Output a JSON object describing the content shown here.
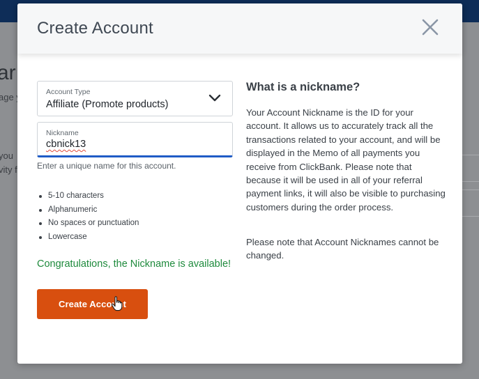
{
  "modal": {
    "title": "Create Account",
    "close_icon": "close-icon"
  },
  "form": {
    "account_type": {
      "label": "Account Type",
      "value": "Affiliate (Promote products)"
    },
    "nickname": {
      "label": "Nickname",
      "value": "cbnick13",
      "helper": "Enter a unique name for this account."
    },
    "rules": [
      "5-10 characters",
      "Alphanumeric",
      "No spaces or punctuation",
      "Lowercase"
    ],
    "status": "Congratulations, the Nickname is available!",
    "submit_label": "Create Account"
  },
  "info": {
    "title": "What is a nickname?",
    "body": "Your Account Nickname is the ID for your account. It allows us to accurately track all the transactions related to your account, and will be displayed in the Memo of all payments you receive from ClickBank. Please note that because it will be used in all of your referral payment links, it will also be visible to purchasing customers during the order process.",
    "note": "Please note that Account Nicknames cannot be changed."
  },
  "colors": {
    "primary_button": "#d84f0f",
    "success_text": "#1e8a3c",
    "focus_underline": "#1f5cc6",
    "top_bar": "#0e2d58"
  }
}
